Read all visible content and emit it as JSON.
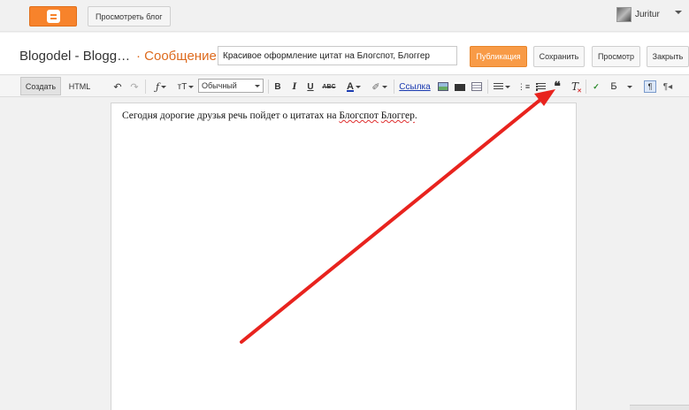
{
  "topbar": {
    "view_blog_label": "Просмотреть блог",
    "user_name": "Juritur"
  },
  "header": {
    "blog_title": "Blogodel - Blogg…",
    "post_label": "· Сообщение",
    "post_title_value": "Красивое оформление цитат на Блогспот, Блоггер",
    "publish_label": "Публикация",
    "save_label": "Сохранить",
    "preview_label": "Просмотр",
    "close_label": "Закрыть"
  },
  "toolbar": {
    "compose_tab": "Создать",
    "html_tab": "HTML",
    "font_size_value": "Обычный",
    "bold_label": "B",
    "italic_label": "I",
    "underline_label": "U",
    "strike_label": "ABC",
    "text_color_label": "A",
    "link_label": "Ссылка",
    "language_label": "Б"
  },
  "editor": {
    "text_before": "Сегодня дорогие друзья речь пойдет о цитатах на ",
    "text_spell1": "Блогспот",
    "text_mid": " ",
    "text_spell2": "Блоггер",
    "text_after": "."
  },
  "colors": {
    "accent_orange": "#dd6a1d",
    "publish_bg": "#f89b47",
    "arrow_red": "#e8231e",
    "link_blue": "#1a3ab0"
  }
}
